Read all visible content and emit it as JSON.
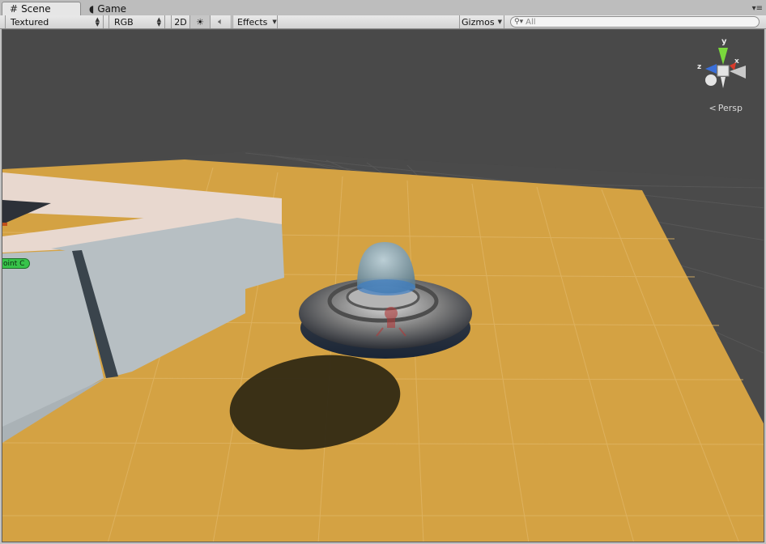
{
  "tabs": [
    {
      "label": "Scene",
      "icon": "grid-hash-icon",
      "active": true
    },
    {
      "label": "Game",
      "icon": "pacman-icon",
      "active": false
    }
  ],
  "toolbar": {
    "render_mode": "Textured",
    "color_mode": "RGB",
    "toggle_2d": "2D",
    "lighting_icon": "sun-icon",
    "audio_icon": "speaker-icon",
    "effects_label": "Effects",
    "gizmos_label": "Gizmos",
    "search_placeholder": "All"
  },
  "scene": {
    "projection_label": "Persp",
    "axis_labels": {
      "x": "x",
      "y": "y",
      "z": "z"
    },
    "waypoint_label": "oint C",
    "colors": {
      "background": "#494949",
      "floor": "#d4a243",
      "walls": "#b7bfc3",
      "wall_top": "#e8d8cf",
      "waypoint": "#37c34a"
    }
  }
}
